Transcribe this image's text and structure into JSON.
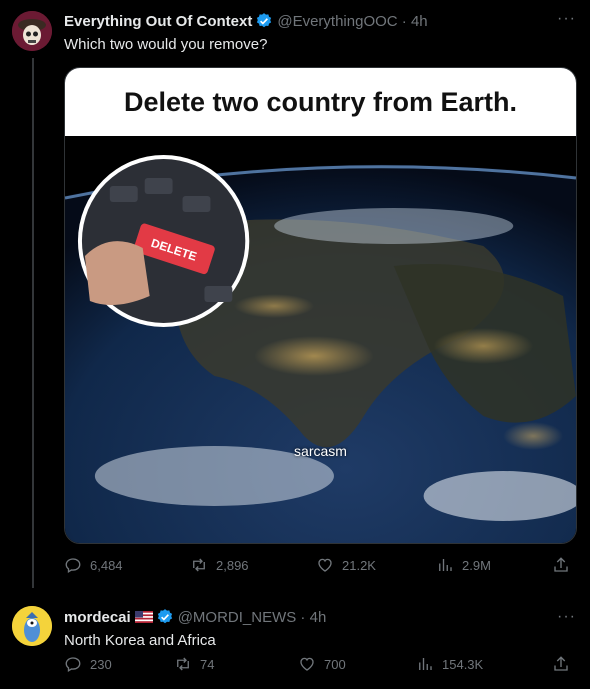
{
  "tweets": [
    {
      "name": "Everything Out Of Context",
      "handle": "@EverythingOOC · 4h",
      "text": "Which two would you remove?",
      "media": {
        "headline": "Delete two country from Earth.",
        "caption": "sarcasm",
        "key_label": "DELETE"
      },
      "stats": {
        "replies": "6,484",
        "reposts": "2,896",
        "likes": "21.2K",
        "views": "2.9M"
      }
    },
    {
      "name": "mordecai",
      "handle": "@MORDI_NEWS · 4h",
      "text": "North Korea and Africa",
      "stats": {
        "replies": "230",
        "reposts": "74",
        "likes": "700",
        "views": "154.3K"
      }
    }
  ],
  "more_label": "···",
  "colors": {
    "background": "#000000",
    "text": "#e7e9ea",
    "muted": "#71767b",
    "verified": "#1d9bf0"
  }
}
